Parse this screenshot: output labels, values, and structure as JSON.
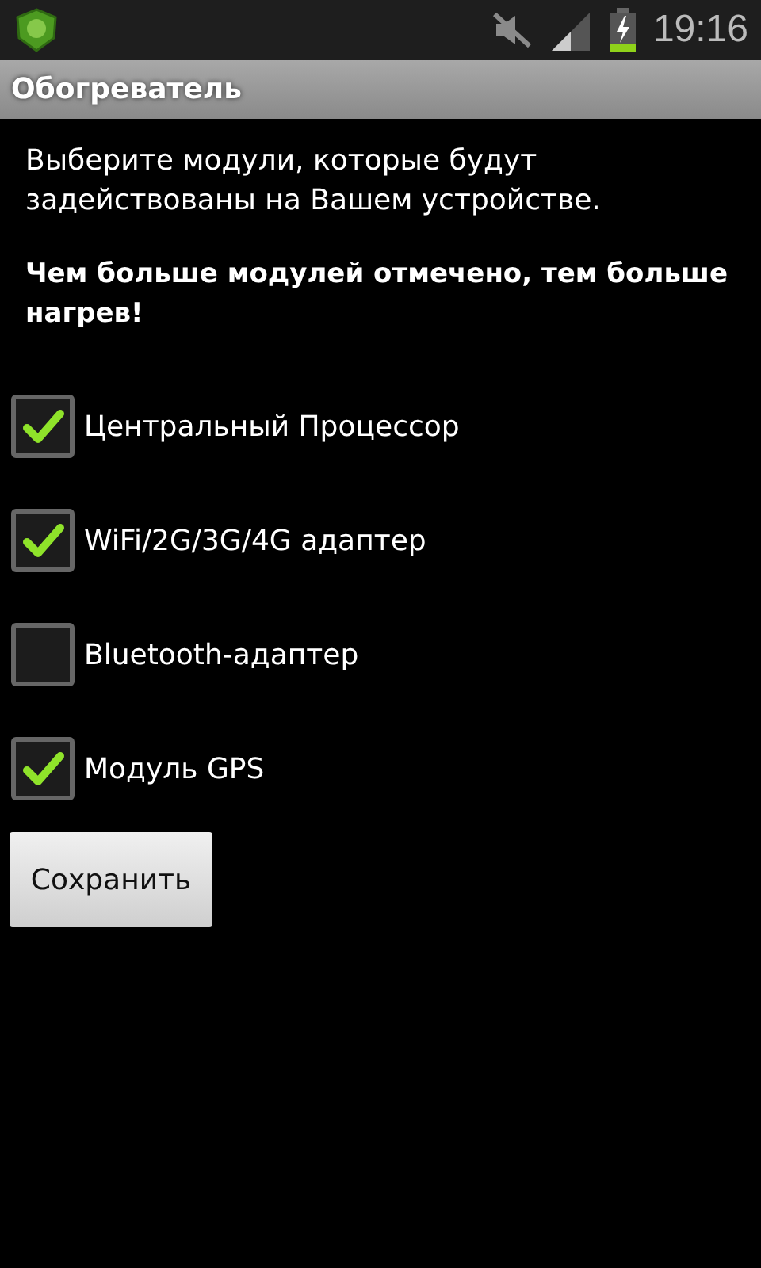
{
  "status_bar": {
    "time": "19:16"
  },
  "window": {
    "title": "Обогреватель"
  },
  "intro": "Выберите модули, которые будут задействованы на Вашем устройстве.",
  "warning": "Чем больше модулей отмечено, тем больше нагрев!",
  "modules": [
    {
      "label": "Центральный Процессор",
      "checked": true
    },
    {
      "label": "WiFi/2G/3G/4G адаптер",
      "checked": true
    },
    {
      "label": "Bluetooth-адаптер",
      "checked": false
    },
    {
      "label": "Модуль GPS",
      "checked": true
    }
  ],
  "buttons": [
    "Сохранить"
  ]
}
